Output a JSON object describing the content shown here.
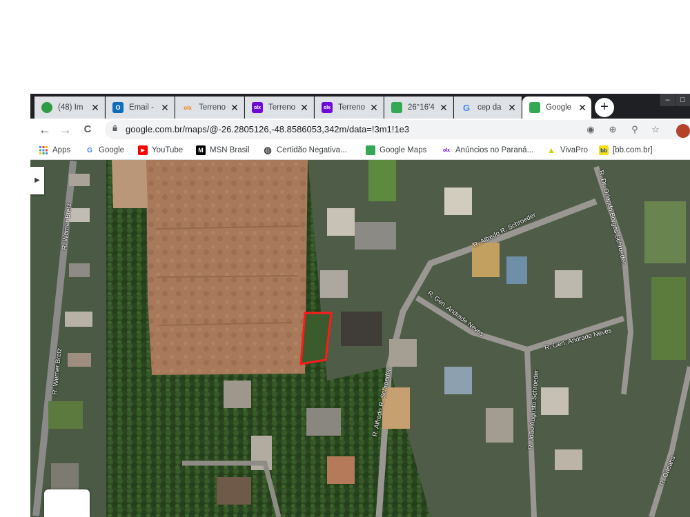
{
  "tabs": [
    {
      "title": "(48) Im",
      "favicon": "whatsapp-icon",
      "color": "#2e9c44"
    },
    {
      "title": "Email -",
      "favicon": "outlook-icon",
      "color": "#0f6cbd"
    },
    {
      "title": "Terreno",
      "favicon": "olx-icon",
      "color": "#f28000"
    },
    {
      "title": "Terreno",
      "favicon": "olx-icon",
      "color": "#6e0ad6"
    },
    {
      "title": "Terreno",
      "favicon": "olx-icon",
      "color": "#6e0ad6"
    },
    {
      "title": "26°16'4",
      "favicon": "google-maps-icon",
      "color": "#34a853"
    },
    {
      "title": "cep da",
      "favicon": "google-icon",
      "color": "#4285f4"
    },
    {
      "title": "Google",
      "favicon": "google-maps-icon",
      "color": "#34a853"
    }
  ],
  "new_tab_label": "+",
  "window_controls": {
    "minimize": "–",
    "maximize": "□",
    "close": "✕"
  },
  "toolbar": {
    "back": "←",
    "forward": "→",
    "reload": "C",
    "url": "google.com.br/maps/@-26.2805126,-48.8586053,342m/data=!3m1!1e3"
  },
  "bookmarks": [
    {
      "label": "Apps",
      "icon": "apps-grid-icon",
      "color": "#4285f4"
    },
    {
      "label": "Google",
      "icon": "google-icon",
      "color": "#4285f4"
    },
    {
      "label": "YouTube",
      "icon": "youtube-icon",
      "color": "#ff0000"
    },
    {
      "label": "MSN Brasil",
      "icon": "msn-icon",
      "color": "#000000"
    },
    {
      "label": "Certidão Negativa...",
      "icon": "globe-icon",
      "color": "#5f6368"
    },
    {
      "label": "Google Maps",
      "icon": "google-maps-icon",
      "color": "#34a853"
    },
    {
      "label": "Anúncios no Paraná...",
      "icon": "olx-icon",
      "color": "#6e0ad6"
    },
    {
      "label": "VivaPro",
      "icon": "vivapro-icon",
      "color": "#c8d400"
    },
    {
      "label": "[bb.com.br]",
      "icon": "bb-icon",
      "color": "#f9dd16"
    }
  ],
  "map": {
    "streets": [
      "R. Werner Bretz",
      "R. Werner Bretz",
      "R. Alfredo R. Schroeder",
      "R. Dr. Orlando Borges Schroeder",
      "R. Gen. Andrade Neves",
      "R. Gen. Andrade Neves",
      "R. Alfredo R. Schroeder",
      "R. João Augusto Schroeder",
      "R. Orleans"
    ],
    "marker_color": "#ff1a1a"
  }
}
